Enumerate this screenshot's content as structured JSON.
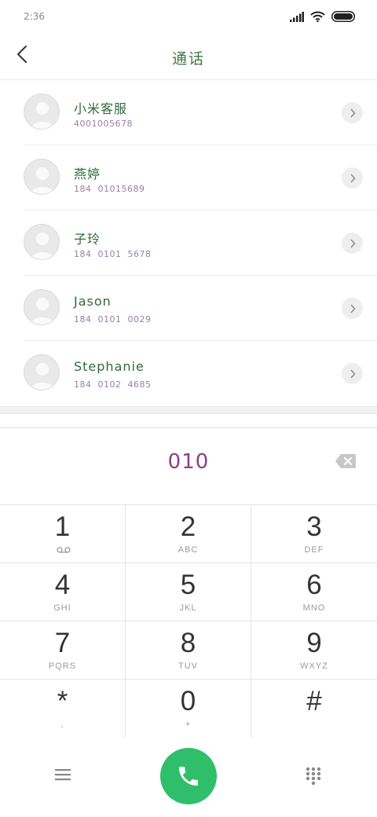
{
  "status_bar": {
    "time": "2:36"
  },
  "header": {
    "title": "通话"
  },
  "contacts": [
    {
      "name": "小米客服",
      "number": "4001005678"
    },
    {
      "name": "燕婷",
      "number": "184  01015689"
    },
    {
      "name": "子玲",
      "number": "184  0101  5678"
    },
    {
      "name": "Jason",
      "number": "184  0101  0029"
    },
    {
      "name": "Stephanie",
      "number": "184  0102  4685"
    }
  ],
  "dialer": {
    "input": "010"
  },
  "keypad": [
    {
      "digit": "1",
      "letters": ""
    },
    {
      "digit": "2",
      "letters": "ABC"
    },
    {
      "digit": "3",
      "letters": "DEF"
    },
    {
      "digit": "4",
      "letters": "GHI"
    },
    {
      "digit": "5",
      "letters": "JKL"
    },
    {
      "digit": "6",
      "letters": "MNO"
    },
    {
      "digit": "7",
      "letters": "PQRS"
    },
    {
      "digit": "8",
      "letters": "TUV"
    },
    {
      "digit": "9",
      "letters": "WXYZ"
    },
    {
      "digit": "*",
      "letters": ","
    },
    {
      "digit": "0",
      "letters": "+"
    },
    {
      "digit": "#",
      "letters": ""
    }
  ],
  "icons": {
    "signal": "signal-icon",
    "wifi": "wifi-icon",
    "battery": "battery-icon",
    "back": "back-arrow-icon",
    "chevron": "chevron-right-icon",
    "avatar": "avatar-placeholder-icon",
    "delete": "backspace-icon",
    "voicemail": "voicemail-icon",
    "menu": "menu-icon",
    "phone": "phone-icon",
    "keypad": "dialpad-icon"
  },
  "colors": {
    "call_button": "#2fbf6b",
    "title": "#3d7a3d",
    "dial_number": "#8c3d8c"
  }
}
